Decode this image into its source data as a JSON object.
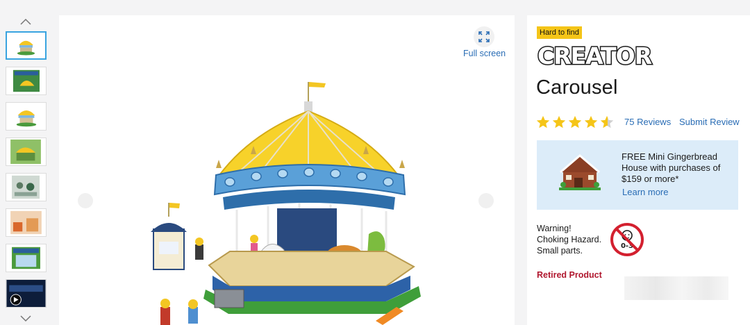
{
  "gallery": {
    "prev_icon": "chevron-up-icon",
    "next_icon": "chevron-down-icon",
    "thumbnails": [
      {
        "name": "thumb-carousel-front",
        "active": true
      },
      {
        "name": "thumb-box-art",
        "active": false
      },
      {
        "name": "thumb-carousel-side",
        "active": false
      },
      {
        "name": "thumb-lifestyle-green",
        "active": false
      },
      {
        "name": "thumb-minifigures",
        "active": false
      },
      {
        "name": "thumb-lifestyle-orange",
        "active": false
      },
      {
        "name": "thumb-box-back",
        "active": false
      },
      {
        "name": "thumb-video",
        "active": false
      }
    ]
  },
  "viewer": {
    "fullscreen_label": "Full screen",
    "fullscreen_icon": "expand-icon"
  },
  "product": {
    "badge": "Hard to find",
    "brand": "CREATOR",
    "title": "Carousel",
    "rating": 4.5,
    "rating_max": 5,
    "reviews_label": "75 Reviews",
    "submit_review_label": "Submit Review",
    "promo": {
      "text": "FREE Mini Gingerbread House with purchases of $159 or more*",
      "link": "Learn more"
    },
    "warning": {
      "line1": "Warning!",
      "line2": "Choking Hazard.",
      "line3": "Small parts.",
      "age_label": "0-3"
    },
    "status": "Retired Product"
  },
  "colors": {
    "accent_link": "#2a6db5",
    "badge_bg": "#f5c518",
    "star": "#f5c518",
    "retired": "#b0172e",
    "promo_bg": "#dcecf9"
  }
}
